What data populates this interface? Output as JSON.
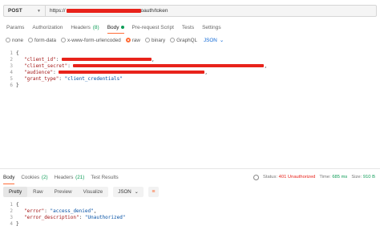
{
  "request": {
    "method": "POST",
    "url_prefix": "https://",
    "url_suffix": "oauth/token"
  },
  "req_tabs": [
    {
      "label": "Params"
    },
    {
      "label": "Authorization"
    },
    {
      "label": "Headers",
      "count": "(8)"
    },
    {
      "label": "Body"
    },
    {
      "label": "Pre-request Script"
    },
    {
      "label": "Tests"
    },
    {
      "label": "Settings"
    }
  ],
  "body_options": {
    "none": "none",
    "form_data": "form-data",
    "urlencoded": "x-www-form-urlencoded",
    "raw": "raw",
    "binary": "binary",
    "graphql": "GraphQL",
    "lang": "JSON"
  },
  "req_body": {
    "line_numbers": [
      "1",
      "2",
      "3",
      "4",
      "5",
      "6"
    ],
    "open": "{",
    "close": "}",
    "client_id_key": "\"client_id\"",
    "client_secret_key": "\"client_secret\"",
    "audience_key": "\"audience\"",
    "grant_type_key": "\"grant_type\"",
    "grant_type_val": "\"client_credentials\"",
    "colon": ":",
    "comma": ","
  },
  "resp_tabs": [
    {
      "label": "Body"
    },
    {
      "label": "Cookies",
      "count": "(2)"
    },
    {
      "label": "Headers",
      "count": "(21)"
    },
    {
      "label": "Test Results"
    }
  ],
  "status": {
    "status_label": "Status:",
    "status_value": "401 Unauthorized",
    "time_label": "Time:",
    "time_value": "685 ms",
    "size_label": "Size:",
    "size_value": "910 B"
  },
  "resp_toolbar": {
    "pretty": "Pretty",
    "raw": "Raw",
    "preview": "Preview",
    "visualize": "Visualize",
    "format": "JSON"
  },
  "resp_body": {
    "line_numbers": [
      "1",
      "2",
      "3",
      "4"
    ],
    "open": "{",
    "close": "}",
    "error_key": "\"error\"",
    "error_val": "\"access_denied\"",
    "desc_key": "\"error_description\"",
    "desc_val": "\"Unauthorized\""
  },
  "colors": {
    "accent": "#ff6c37",
    "redaction": "#e8231b",
    "status_error": "#e8231b",
    "success": "#0f9d58"
  }
}
